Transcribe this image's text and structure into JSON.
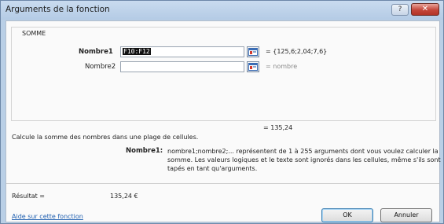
{
  "window": {
    "title": "Arguments de la fonction",
    "help_label": "?",
    "close_label": "✕"
  },
  "function": {
    "name": "SOMME",
    "args": [
      {
        "label": "Nombre1",
        "value": "F10:F12",
        "result": "= {125,6;2,04;7,6}"
      },
      {
        "label": "Nombre2",
        "value": "",
        "result": "= nombre"
      }
    ],
    "total_result": "= 135,24",
    "description": "Calcule la somme des nombres dans une plage de cellules.",
    "arg_help_label": "Nombre1:",
    "arg_help_lines": [
      "nombre1;nombre2;... représentent de 1 à 255 arguments dont vous voulez calculer la",
      "somme. Les valeurs logiques et le texte sont ignorés dans les cellules, même s'ils sont",
      "tapés en tant qu'arguments."
    ]
  },
  "result": {
    "label": "Résultat =",
    "value": "135,24 €"
  },
  "footer": {
    "help_link": "Aide sur cette fonction",
    "ok_label": "OK",
    "cancel_label": "Annuler"
  },
  "colors": {
    "accent_link": "#1f5fb0",
    "close_button": "#c4463a",
    "frame": "#b9cfe6"
  },
  "icons": [
    "collapse-dialog-icon",
    "help-icon",
    "close-icon"
  ]
}
